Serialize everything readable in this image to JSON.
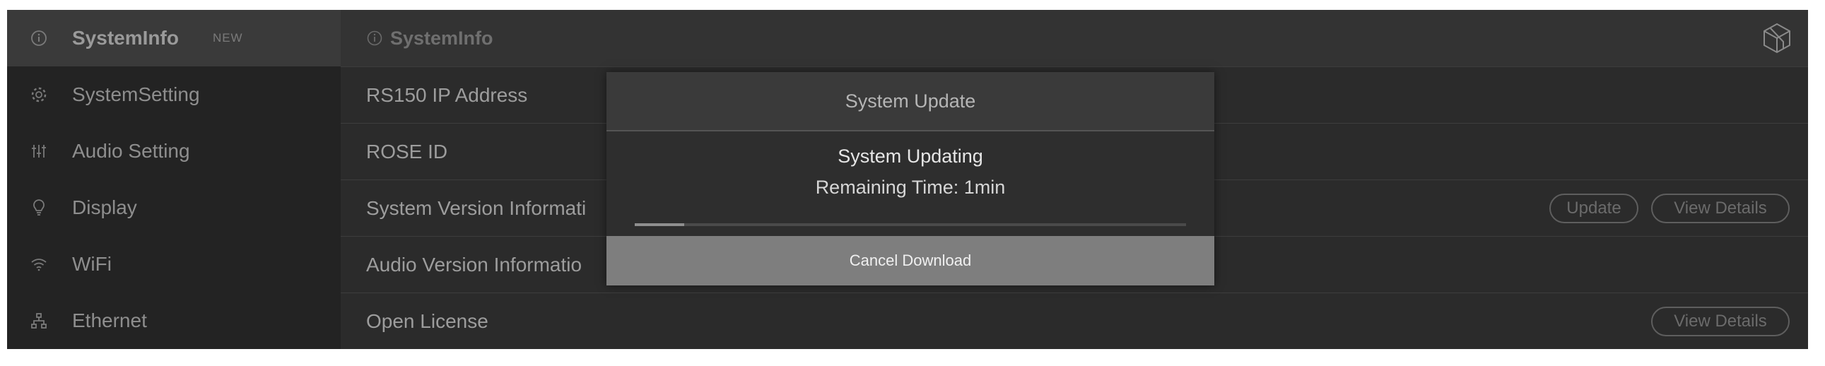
{
  "sidebar": {
    "items": [
      {
        "label": "SystemInfo",
        "icon": "info-icon",
        "badge": "NEW",
        "active": true
      },
      {
        "label": "SystemSetting",
        "icon": "gear-icon"
      },
      {
        "label": "Audio Setting",
        "icon": "equalizer-icon"
      },
      {
        "label": "Display",
        "icon": "bulb-icon"
      },
      {
        "label": "WiFi",
        "icon": "wifi-icon"
      },
      {
        "label": "Ethernet",
        "icon": "network-icon"
      }
    ]
  },
  "header": {
    "title": "SystemInfo",
    "logo_icon": "cube-logo-icon"
  },
  "rows": [
    {
      "label": "RS150 IP Address"
    },
    {
      "label": "ROSE ID"
    },
    {
      "label": "System Version Informati",
      "update_label": "Update",
      "details_label": "View Details"
    },
    {
      "label": "Audio Version Informatio"
    },
    {
      "label": "Open License",
      "details_label": "View Details"
    }
  ],
  "modal": {
    "title": "System Update",
    "status": "System Updating",
    "remaining": "Remaining Time: 1min",
    "progress": 0.09,
    "cancel_label": "Cancel Download"
  },
  "colors": {
    "background": "#2b2b2b",
    "sidebar": "#232323",
    "sidebar_active": "#3a3a3a",
    "modal_button": "#7e7e7e"
  }
}
